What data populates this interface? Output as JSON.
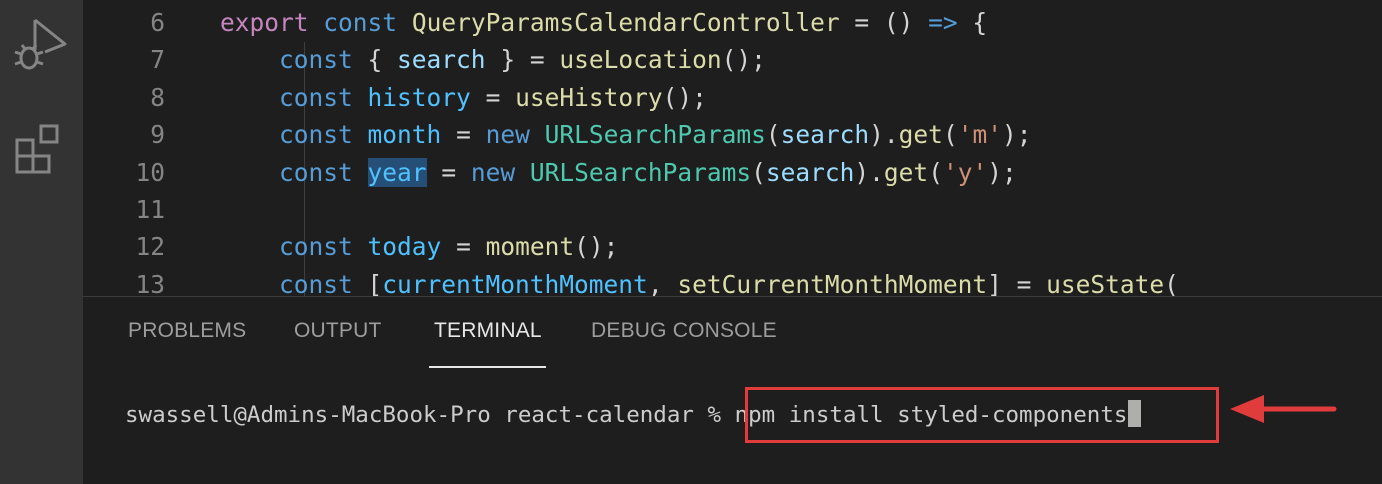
{
  "editor": {
    "lines": [
      {
        "num": "6",
        "tokens": [
          [
            "kw2",
            "export"
          ],
          [
            "pun",
            " "
          ],
          [
            "kw",
            "const"
          ],
          [
            "pun",
            " "
          ],
          [
            "fn",
            "QueryParamsCalendarController"
          ],
          [
            "pun",
            " = () "
          ],
          [
            "kw",
            "=>"
          ],
          [
            "pun",
            " {"
          ]
        ]
      },
      {
        "num": "7",
        "tokens": [
          [
            "pun",
            "    "
          ],
          [
            "kw",
            "const"
          ],
          [
            "pun",
            " { "
          ],
          [
            "var",
            "search"
          ],
          [
            "pun",
            " } = "
          ],
          [
            "fn",
            "useLocation"
          ],
          [
            "pun",
            "();"
          ]
        ]
      },
      {
        "num": "8",
        "tokens": [
          [
            "pun",
            "    "
          ],
          [
            "kw",
            "const"
          ],
          [
            "pun",
            " "
          ],
          [
            "cst",
            "history"
          ],
          [
            "pun",
            " = "
          ],
          [
            "fn",
            "useHistory"
          ],
          [
            "pun",
            "();"
          ]
        ]
      },
      {
        "num": "9",
        "tokens": [
          [
            "pun",
            "    "
          ],
          [
            "kw",
            "const"
          ],
          [
            "pun",
            " "
          ],
          [
            "cst",
            "month"
          ],
          [
            "pun",
            " = "
          ],
          [
            "kw",
            "new"
          ],
          [
            "pun",
            " "
          ],
          [
            "cls",
            "URLSearchParams"
          ],
          [
            "pun",
            "("
          ],
          [
            "var",
            "search"
          ],
          [
            "pun",
            ")."
          ],
          [
            "fn",
            "get"
          ],
          [
            "pun",
            "("
          ],
          [
            "str",
            "'m'"
          ],
          [
            "pun",
            ");"
          ]
        ]
      },
      {
        "num": "10",
        "tokens": [
          [
            "pun",
            "    "
          ],
          [
            "kw",
            "const"
          ],
          [
            "pun",
            " "
          ],
          [
            "cst hl",
            "year"
          ],
          [
            "pun",
            " = "
          ],
          [
            "kw",
            "new"
          ],
          [
            "pun",
            " "
          ],
          [
            "cls",
            "URLSearchParams"
          ],
          [
            "pun",
            "("
          ],
          [
            "var",
            "search"
          ],
          [
            "pun",
            ")."
          ],
          [
            "fn",
            "get"
          ],
          [
            "pun",
            "("
          ],
          [
            "str",
            "'y'"
          ],
          [
            "pun",
            ");"
          ]
        ]
      },
      {
        "num": "11",
        "tokens": []
      },
      {
        "num": "12",
        "tokens": [
          [
            "pun",
            "    "
          ],
          [
            "kw",
            "const"
          ],
          [
            "pun",
            " "
          ],
          [
            "cst",
            "today"
          ],
          [
            "pun",
            " = "
          ],
          [
            "fn",
            "moment"
          ],
          [
            "pun",
            "();"
          ]
        ]
      },
      {
        "num": "13",
        "tokens": [
          [
            "pun",
            "    "
          ],
          [
            "kw",
            "const"
          ],
          [
            "pun",
            " ["
          ],
          [
            "cst",
            "currentMonthMoment"
          ],
          [
            "pun",
            ", "
          ],
          [
            "fn",
            "setCurrentMonthMoment"
          ],
          [
            "pun",
            "] = "
          ],
          [
            "fn",
            "useState"
          ],
          [
            "pun",
            "("
          ]
        ]
      }
    ]
  },
  "panel": {
    "tabs": [
      {
        "label": "PROBLEMS",
        "active": false
      },
      {
        "label": "OUTPUT",
        "active": false
      },
      {
        "label": "TERMINAL",
        "active": true
      },
      {
        "label": "DEBUG CONSOLE",
        "active": false
      }
    ],
    "terminal": {
      "prompt": "swassell@Admins-MacBook-Pro react-calendar % ",
      "command": "npm install styled-components"
    }
  },
  "colors": {
    "annotation": "#e03c3c",
    "background": "#1e1e1e",
    "activity_bar": "#333333"
  },
  "icons": [
    "run-debug-icon",
    "extensions-icon",
    "annotation-arrow-icon"
  ]
}
